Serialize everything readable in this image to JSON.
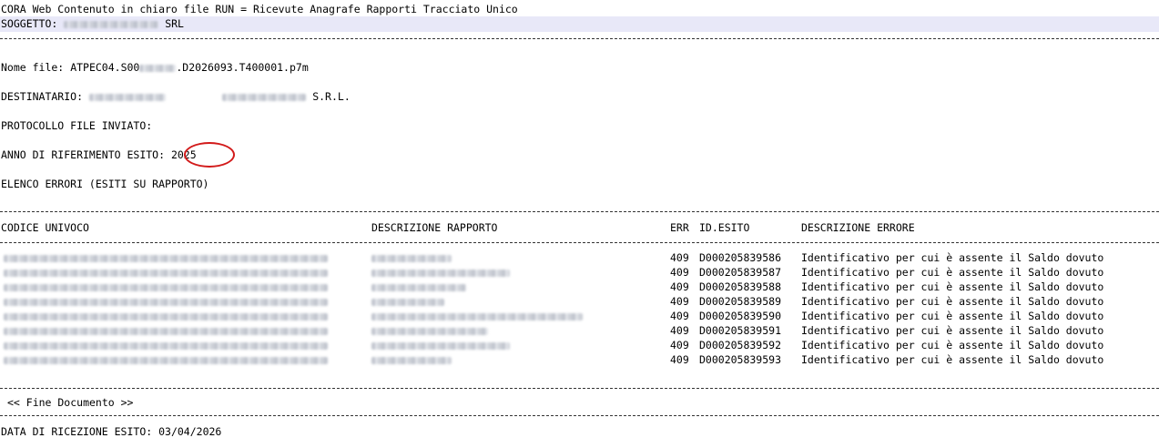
{
  "header": {
    "title": "CORA Web Contenuto in chiaro file RUN = Ricevute Anagrafe Rapporti Tracciato Unico",
    "soggetto_label": "SOGGETTO:",
    "soggetto_suffix": "SRL"
  },
  "file": {
    "nome_label": "Nome file:",
    "nome_prefix": "ATPEC04.S00",
    "nome_suffix": ".D2026093.T400001.p7m",
    "destinatario_label": "DESTINATARIO:",
    "destinatario_suffix": "S.R.L.",
    "protocollo_label": "PROTOCOLLO FILE INVIATO:",
    "anno_label": "ANNO DI RIFERIMENTO ESITO:",
    "anno_value": "2025",
    "elenco_label": "ELENCO ERRORI (ESITI SU RAPPORTO)"
  },
  "table": {
    "headers": {
      "codice": "CODICE UNIVOCO",
      "descrizione_rapporto": "DESCRIZIONE RAPPORTO",
      "err": "ERR",
      "id_esito": "ID.ESITO",
      "descrizione_errore": "DESCRIZIONE ERRORE"
    },
    "rows": [
      {
        "err": "409",
        "id": "D000205839586",
        "desc": "Identificativo per cui è assente il Saldo dovuto"
      },
      {
        "err": "409",
        "id": "D000205839587",
        "desc": "Identificativo per cui è assente il Saldo dovuto"
      },
      {
        "err": "409",
        "id": "D000205839588",
        "desc": "Identificativo per cui è assente il Saldo dovuto"
      },
      {
        "err": "409",
        "id": "D000205839589",
        "desc": "Identificativo per cui è assente il Saldo dovuto"
      },
      {
        "err": "409",
        "id": "D000205839590",
        "desc": "Identificativo per cui è assente il Saldo dovuto"
      },
      {
        "err": "409",
        "id": "D000205839591",
        "desc": "Identificativo per cui è assente il Saldo dovuto"
      },
      {
        "err": "409",
        "id": "D000205839592",
        "desc": "Identificativo per cui è assente il Saldo dovuto"
      },
      {
        "err": "409",
        "id": "D000205839593",
        "desc": "Identificativo per cui è assente il Saldo dovuto"
      }
    ]
  },
  "footer": {
    "fine": "<< Fine Documento >>",
    "data_label": "DATA DI RICEZIONE ESITO:",
    "data_value": "03/04/2026"
  },
  "colors": {
    "band": "#e8e8f8",
    "highlight_circle": "#d21a1a"
  }
}
